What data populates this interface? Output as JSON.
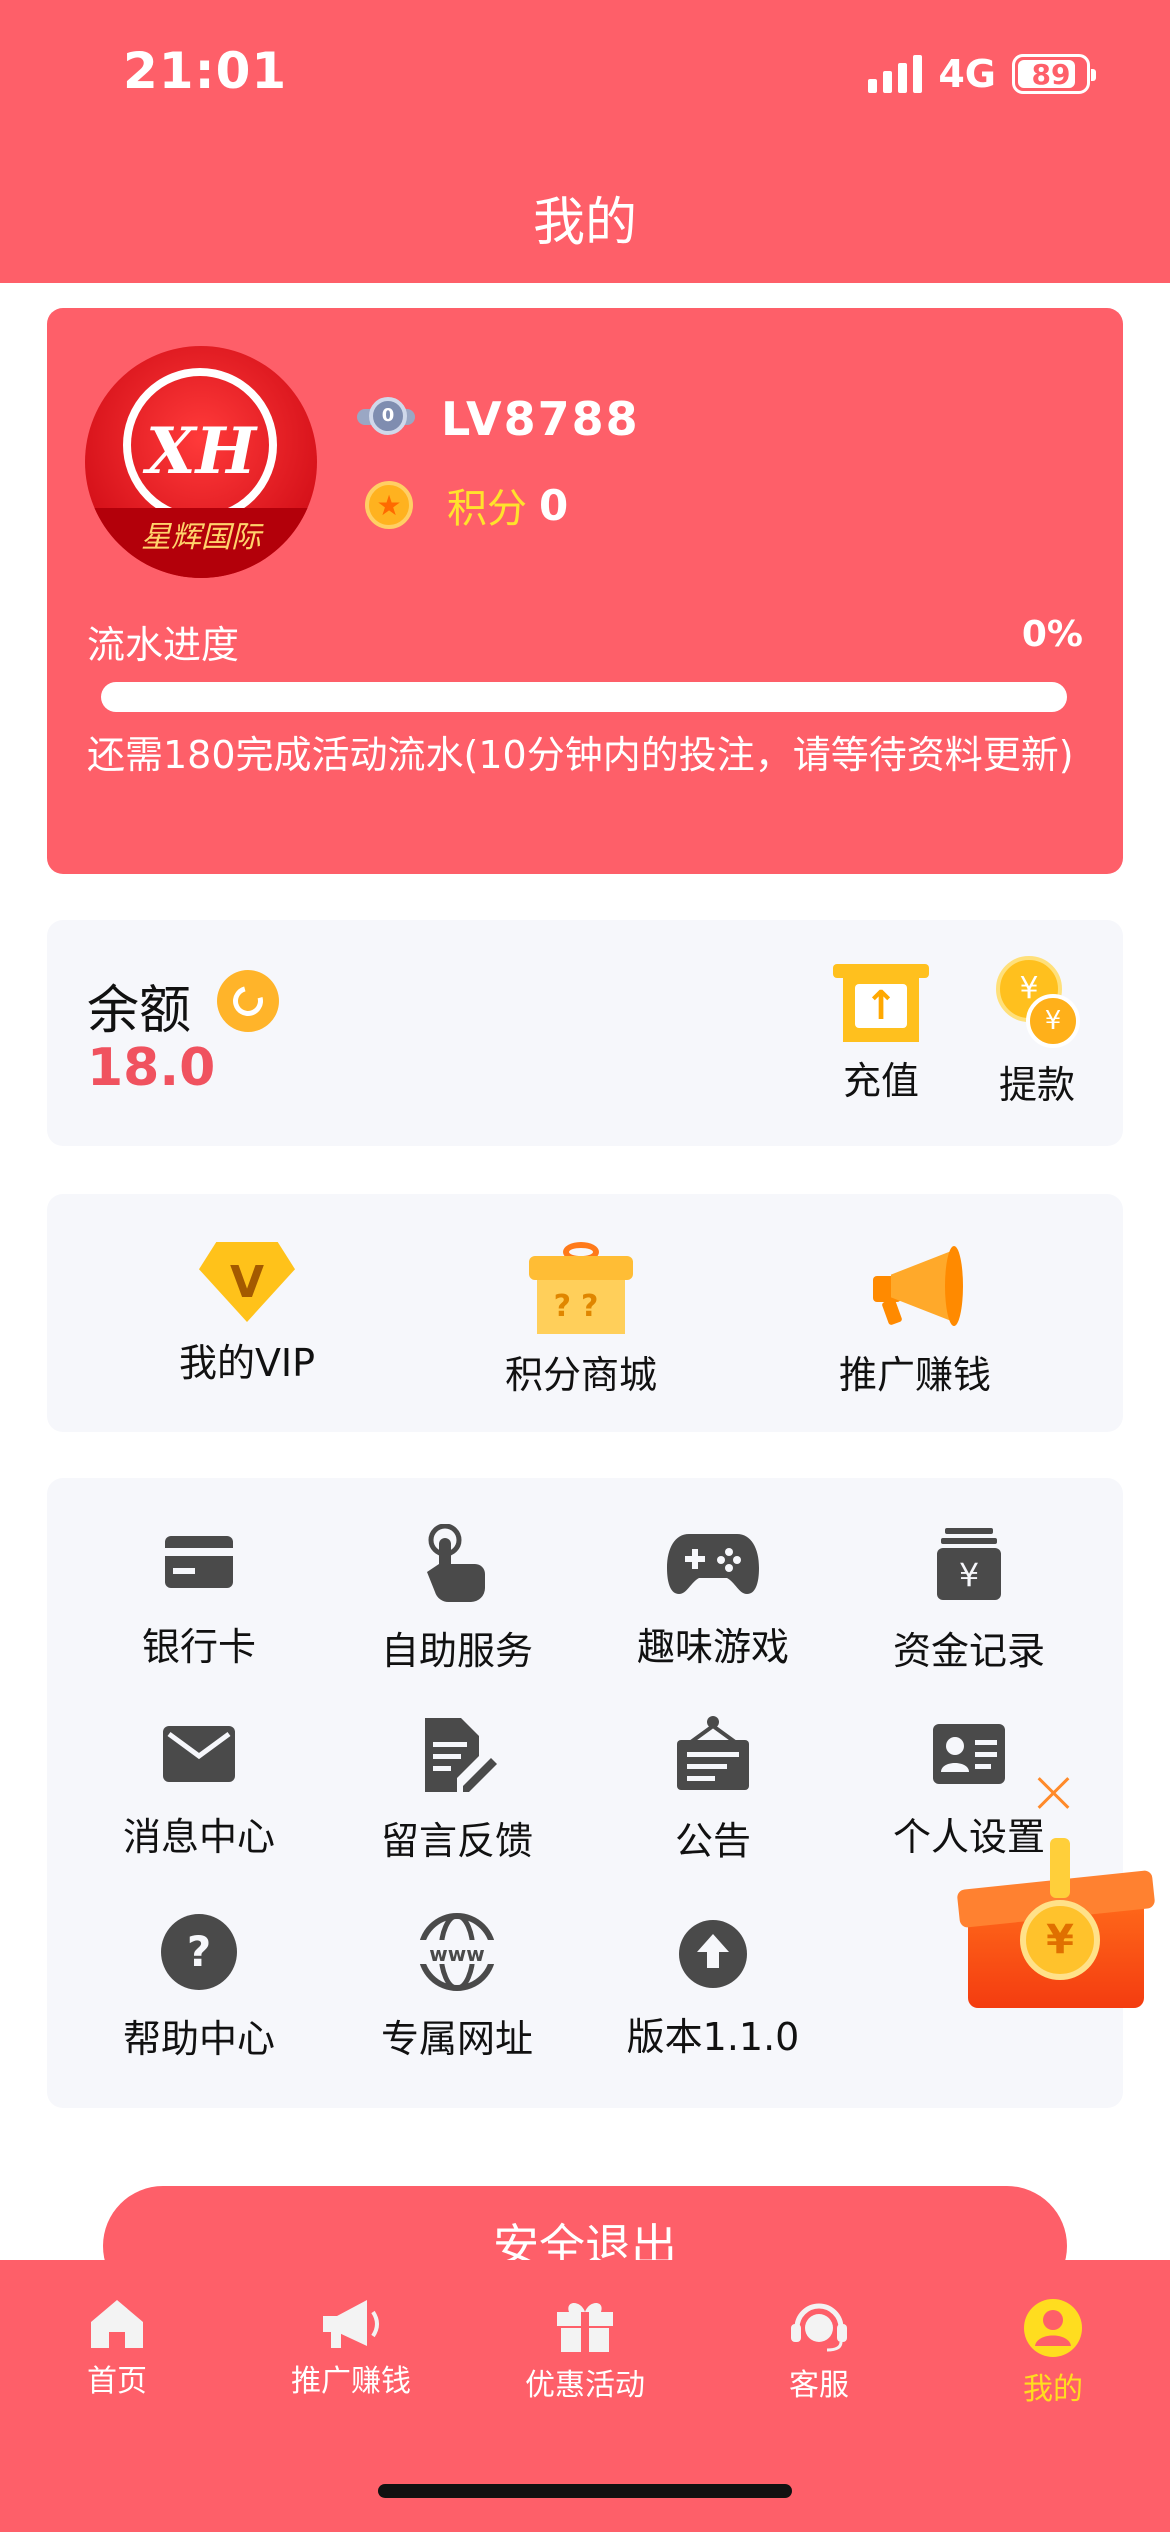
{
  "status_bar": {
    "time": "21:01",
    "network": "4G",
    "battery": "89"
  },
  "header": {
    "title": "我的"
  },
  "profile": {
    "avatar_caption": "星辉国际",
    "avatar_monogram": "XH",
    "level_badge": "0",
    "level": "LV8788",
    "points_label": "积分",
    "points_value": "0",
    "progress_label": "流水进度",
    "progress_percent": "0%",
    "progress_fraction": 0,
    "progress_note": "还需180完成活动流水(10分钟内的投注，请等待资料更新)"
  },
  "balance": {
    "label": "余额",
    "value": "18.0",
    "deposit_label": "充值",
    "withdraw_label": "提款"
  },
  "features": [
    {
      "label": "我的VIP",
      "icon": "vip-diamond-icon"
    },
    {
      "label": "积分商城",
      "icon": "gift-box-icon"
    },
    {
      "label": "推广赚钱",
      "icon": "megaphone-icon"
    }
  ],
  "menu": [
    {
      "label": "银行卡",
      "icon": "bank-card-icon"
    },
    {
      "label": "自助服务",
      "icon": "hand-tap-icon"
    },
    {
      "label": "趣味游戏",
      "icon": "gamepad-icon"
    },
    {
      "label": "资金记录",
      "icon": "money-record-icon"
    },
    {
      "label": "消息中心",
      "icon": "mail-icon"
    },
    {
      "label": "留言反馈",
      "icon": "feedback-doc-icon"
    },
    {
      "label": "公告",
      "icon": "notice-board-icon"
    },
    {
      "label": "个人设置",
      "icon": "id-card-icon"
    },
    {
      "label": "帮助中心",
      "icon": "help-icon"
    },
    {
      "label": "专属网址",
      "icon": "www-globe-icon"
    },
    {
      "label": "版本1.1.0",
      "icon": "upload-arrow-icon"
    }
  ],
  "logout_label": "安全退出",
  "tabbar": [
    {
      "label": "首页",
      "icon": "home-icon"
    },
    {
      "label": "推广赚钱",
      "icon": "megaphone-icon"
    },
    {
      "label": "优惠活动",
      "icon": "gift-icon"
    },
    {
      "label": "客服",
      "icon": "headset-icon"
    },
    {
      "label": "我的",
      "icon": "user-icon",
      "active": true
    }
  ],
  "colors": {
    "brand": "#fe5f69",
    "accent_yellow": "#ffdd1f",
    "balance_value": "#f0525f",
    "card_bg": "#f6f7fb",
    "icon_dark": "#4a4a4a"
  }
}
